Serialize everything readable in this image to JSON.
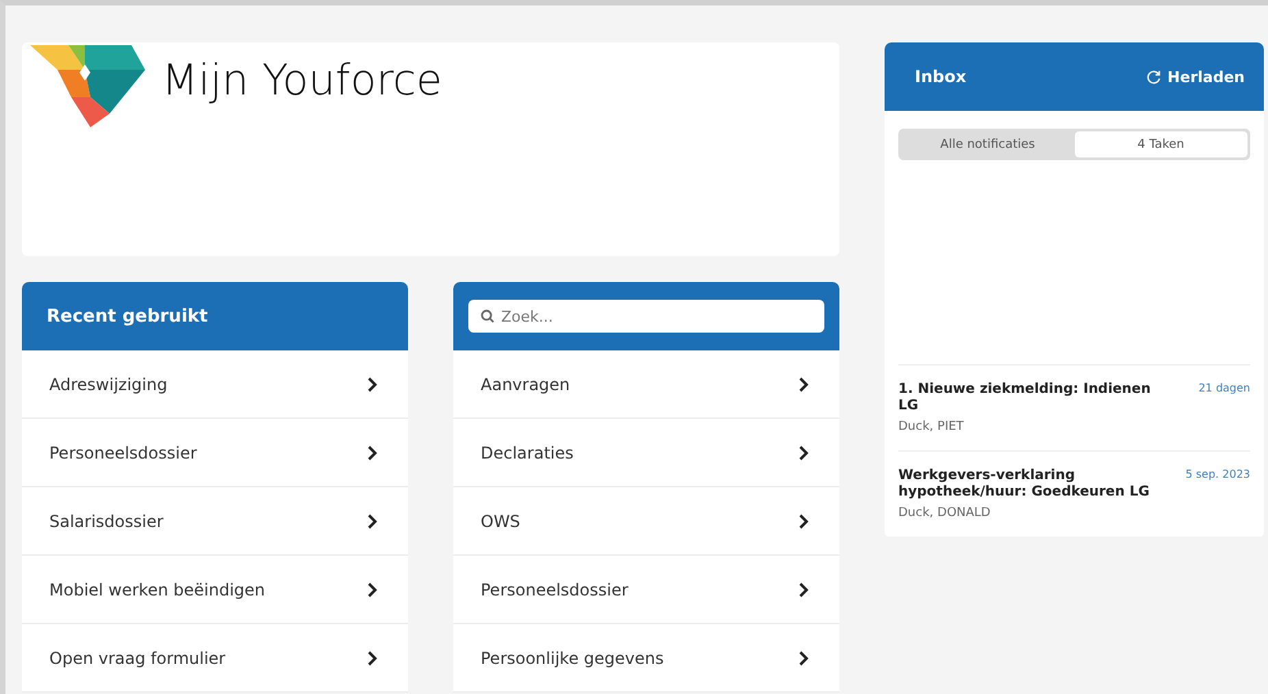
{
  "header": {
    "title": "Mijn Youforce"
  },
  "recent": {
    "title": "Recent gebruikt",
    "items": [
      {
        "label": "Adreswijziging"
      },
      {
        "label": "Personeelsdossier"
      },
      {
        "label": "Salarisdossier"
      },
      {
        "label": "Mobiel werken beëindigen"
      },
      {
        "label": "Open vraag formulier"
      }
    ]
  },
  "catalog": {
    "search": {
      "placeholder": "Zoek..."
    },
    "items": [
      {
        "label": "Aanvragen"
      },
      {
        "label": "Declaraties"
      },
      {
        "label": "OWS"
      },
      {
        "label": "Personeelsdossier"
      },
      {
        "label": "Persoonlijke gegevens"
      }
    ]
  },
  "inbox": {
    "title": "Inbox",
    "reload": "Herladen",
    "tabs": [
      {
        "label": "Alle notificaties",
        "selected": false
      },
      {
        "label": "4 Taken",
        "selected": true
      }
    ],
    "tasks": [
      {
        "title": "1. Nieuwe ziekmelding: Indienen LG",
        "person": "Duck, PIET",
        "date": "21 dagen"
      },
      {
        "title": "Werkgevers-verklaring hypotheek/huur: Goedkeuren LG",
        "person": "Duck, DONALD",
        "date": "5 sep. 2023"
      }
    ]
  }
}
